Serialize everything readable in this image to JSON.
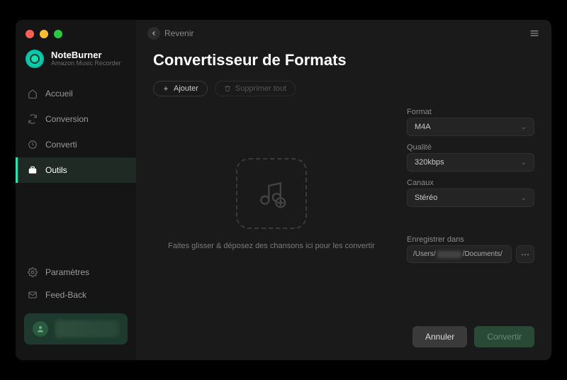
{
  "brand": {
    "title": "NoteBurner",
    "subtitle": "Amazon Music Recorder"
  },
  "sidebar": {
    "items": [
      {
        "label": "Accueil"
      },
      {
        "label": "Conversion"
      },
      {
        "label": "Converti"
      },
      {
        "label": "Outils"
      }
    ],
    "bottom": [
      {
        "label": "Paramètres"
      },
      {
        "label": "Feed-Back"
      }
    ]
  },
  "topbar": {
    "back_label": "Revenir"
  },
  "page": {
    "title": "Convertisseur de Formats",
    "add_label": "Ajouter",
    "delete_all_label": "Supprimer tout",
    "drop_caption": "Faites glisser & déposez des chansons ici pour les convertir"
  },
  "options": {
    "format_label": "Format",
    "format_value": "M4A",
    "quality_label": "Qualité",
    "quality_value": "320kbps",
    "channels_label": "Canaux",
    "channels_value": "Stéréo",
    "save_label": "Enregistrer dans",
    "path_prefix": "/Users/",
    "path_suffix": "/Documents/"
  },
  "footer": {
    "cancel": "Annuler",
    "convert": "Convertir"
  }
}
